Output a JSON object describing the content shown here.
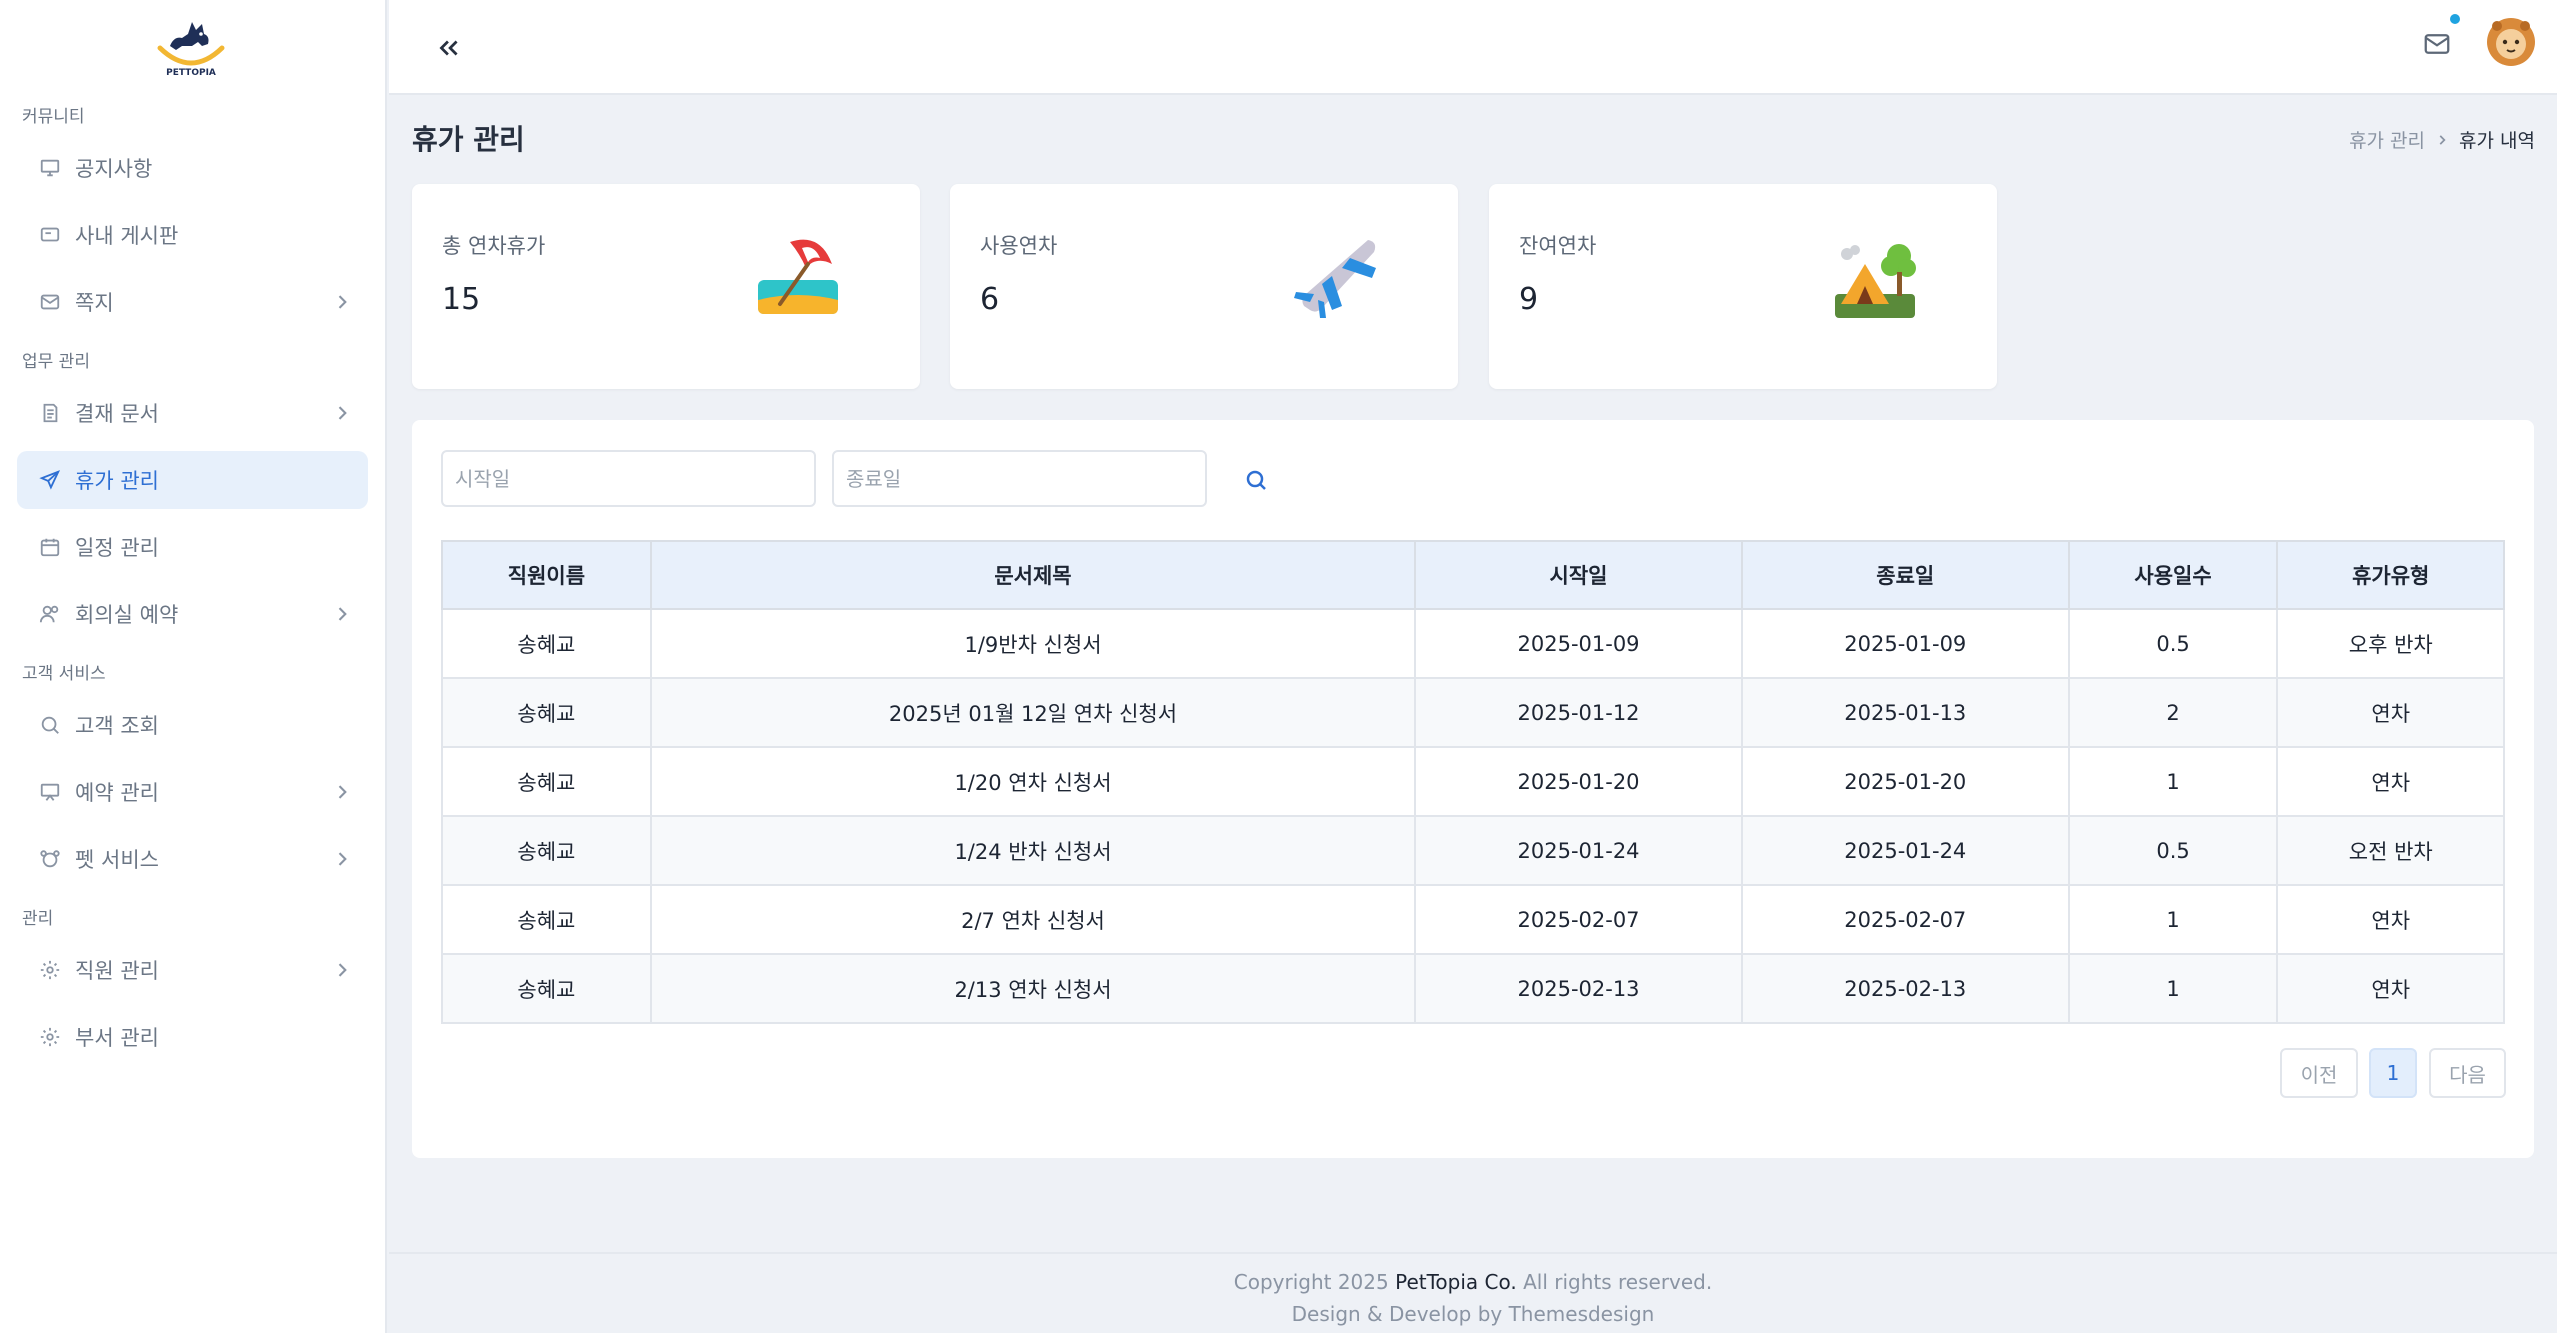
{
  "sidebar": {
    "sections": [
      {
        "label": "커뮤니티"
      },
      {
        "label": "업무 관리"
      },
      {
        "label": "고객 서비스"
      },
      {
        "label": "관리"
      }
    ],
    "items": [
      {
        "label": "공지사항",
        "icon": "monitor-icon"
      },
      {
        "label": "사내 게시판",
        "icon": "board-icon"
      },
      {
        "label": "쪽지",
        "icon": "mail-icon"
      },
      {
        "label": "결재 문서",
        "icon": "document-icon"
      },
      {
        "label": "휴가 관리",
        "icon": "plane-icon",
        "active": true
      },
      {
        "label": "일정 관리",
        "icon": "calendar-icon"
      },
      {
        "label": "회의실 예약",
        "icon": "users-icon"
      },
      {
        "label": "고객 조회",
        "icon": "search-icon"
      },
      {
        "label": "예약 관리",
        "icon": "presentation-icon"
      },
      {
        "label": "펫 서비스",
        "icon": "pet-icon"
      },
      {
        "label": "직원 관리",
        "icon": "gear-icon"
      },
      {
        "label": "부서 관리",
        "icon": "gear-icon"
      }
    ]
  },
  "header": {
    "title": "휴가 관리",
    "breadcrumb": [
      "휴가 관리",
      "휴가 내역"
    ]
  },
  "stats": [
    {
      "label": "총 연차휴가",
      "value": "15",
      "icon": "beach-umbrella-icon"
    },
    {
      "label": "사용연차",
      "value": "6",
      "icon": "airplane-icon"
    },
    {
      "label": "잔여연차",
      "value": "9",
      "icon": "camping-icon"
    }
  ],
  "filters": {
    "start_placeholder": "시작일",
    "end_placeholder": "종료일"
  },
  "table": {
    "columns": [
      "직원이름",
      "문서제목",
      "시작일",
      "종료일",
      "사용일수",
      "휴가유형"
    ],
    "rows": [
      [
        "송혜교",
        "1/9반차 신청서",
        "2025-01-09",
        "2025-01-09",
        "0.5",
        "오후 반차"
      ],
      [
        "송혜교",
        "2025년 01월 12일 연차 신청서",
        "2025-01-12",
        "2025-01-13",
        "2",
        "연차"
      ],
      [
        "송혜교",
        "1/20 연차 신청서",
        "2025-01-20",
        "2025-01-20",
        "1",
        "연차"
      ],
      [
        "송혜교",
        "1/24 반차 신청서",
        "2025-01-24",
        "2025-01-24",
        "0.5",
        "오전 반차"
      ],
      [
        "송혜교",
        "2/7 연차 신청서",
        "2025-02-07",
        "2025-02-07",
        "1",
        "연차"
      ],
      [
        "송혜교",
        "2/13 연차 신청서",
        "2025-02-13",
        "2025-02-13",
        "1",
        "연차"
      ]
    ]
  },
  "pagination": {
    "prev": "이전",
    "current": "1",
    "next": "다음"
  },
  "footer": {
    "copyright_prefix": "Copyright 2025",
    "company": "PetTopia Co.",
    "rights": "All rights reserved.",
    "credit": "Design & Develop by Themesdesign"
  },
  "logo_text": "PETTOPIA",
  "colors": {
    "accent": "#2e6fd3",
    "active_bg": "#e7f0fb",
    "notify": "#1fa3e0"
  }
}
